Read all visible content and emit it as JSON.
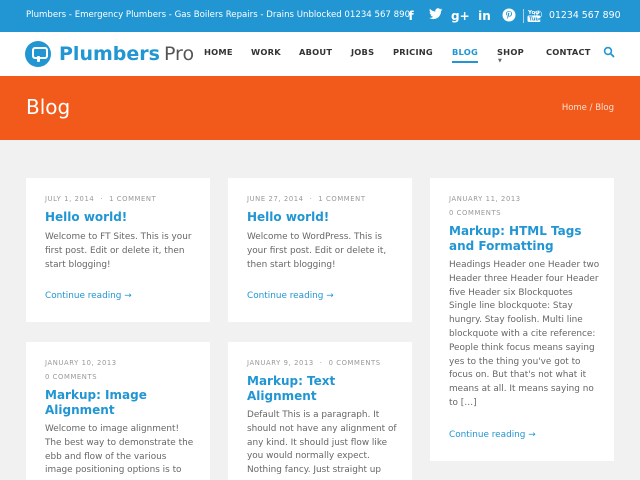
{
  "topbar": {
    "tagline": "Plumbers - Emergency Plumbers - Gas Boilers Repairs - Drains Unblocked 01234 567 890",
    "socials": [
      {
        "name": "facebook-icon",
        "glyph": "f"
      },
      {
        "name": "twitter-icon",
        "glyph": "t"
      },
      {
        "name": "google-plus-icon",
        "glyph": "g+"
      },
      {
        "name": "linkedin-icon",
        "glyph": "in"
      },
      {
        "name": "pinterest-icon",
        "glyph": "P"
      },
      {
        "name": "youtube-icon",
        "glyph": "You"
      }
    ],
    "phone": "01234 567 890"
  },
  "header": {
    "brand": "Plumbers",
    "brand_suffix": "Pro",
    "nav": [
      "HOME",
      "WORK",
      "ABOUT",
      "JOBS",
      "PRICING",
      "BLOG",
      "SHOP",
      "CONTACT"
    ],
    "active": "BLOG"
  },
  "banner": {
    "title": "Blog",
    "breadcrumb_home": "Home",
    "breadcrumb_sep": "/",
    "breadcrumb_current": "Blog"
  },
  "posts": [
    {
      "date": "JULY 1, 2014",
      "comments": "1 COMMENT",
      "title": "Hello world!",
      "excerpt": "Welcome to FT Sites. This is your first post. Edit or delete it, then start blogging!",
      "read_more": "Continue reading →"
    },
    {
      "date": "JUNE 27, 2014",
      "comments": "1 COMMENT",
      "title": "Hello world!",
      "excerpt": "Welcome to WordPress. This is your first post. Edit or delete it, then start blogging!",
      "read_more": "Continue reading →"
    },
    {
      "date": "JANUARY 11, 2013",
      "comments": "0 COMMENTS",
      "title": "Markup: HTML Tags and Formatting",
      "excerpt": "Headings Header one Header two Header three Header four Header five Header six Blockquotes Single line blockquote: Stay hungry. Stay foolish. Multi line blockquote with a cite reference: People think focus means saying yes to the thing you've got to focus on. But that's not what it means at all. It means saying no to […]",
      "read_more": "Continue reading →"
    },
    {
      "date": "JANUARY 10, 2013",
      "comments": "0 COMMENTS",
      "title": "Markup: Image Alignment",
      "excerpt": "Welcome to image alignment! The best way to demonstrate the ebb and flow of the various image positioning options is to",
      "read_more": ""
    },
    {
      "date": "JANUARY 9, 2013",
      "comments": "0 COMMENTS",
      "title": "Markup: Text Alignment",
      "excerpt": "Default This is a paragraph. It should not have any alignment of any kind. It should just flow like you would normally expect. Nothing fancy. Just straight up",
      "read_more": ""
    }
  ]
}
